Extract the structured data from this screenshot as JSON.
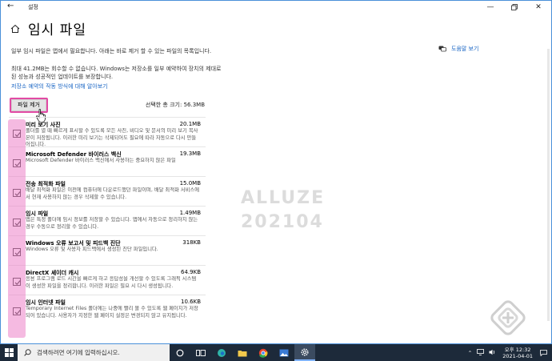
{
  "window": {
    "app_title": "설정",
    "page_title": "임시 파일",
    "description": "일부 임시 파일은 앱에서 필요합니다. 아래는 바로 제거 할 수 있는 파일의 목록입니다.",
    "storage_note": "최대 41.2MB는 회수할 수 없습니다. Windows는 저장소를 일부 예약하여 장치의 제대로 된 성능과 성공적인 업데이트를 보장합니다.",
    "storage_link": "저장소 예약의 작동 방식에 대해 알아보기",
    "help_link": "도움말 보기",
    "remove_button": "파일 제거",
    "selected_size": "선택한 총 크기: 56.3MB"
  },
  "items": [
    {
      "name": "미리 보기 사진",
      "size": "20.1MB",
      "desc": "폴더를 열 때 빠르게 표시할 수 있도록 모든 사진, 비디오 및 문서의 미리 보기 복사본이 저장됩니다. 이러한 미리 보기는 삭제되어도 필요에 따라 자동으로 다시 만들어집니다.",
      "checked": true
    },
    {
      "name": "Microsoft Defender 바이러스 백신",
      "size": "19.3MB",
      "desc": "Microsoft Defender 바이러스 백신에서 사용하는 중요하지 않은 파일",
      "checked": true
    },
    {
      "name": "전송 최적화 파일",
      "size": "15.0MB",
      "desc": "배달 최적화 파일은 이전에 컴퓨터에 다운로드했던 파일이며, 배달 최적화 서비스에서 현재 사용하지 않는 경우 삭제할 수 있습니다.",
      "checked": true
    },
    {
      "name": "임시 파일",
      "size": "1.49MB",
      "desc": "앱은 특정 폴더에 임시 정보를 저장할 수 있습니다. 앱에서 자동으로 정리하지 않는 경우 수동으로 정리할 수 있습니다.",
      "checked": true
    },
    {
      "name": "Windows 오류 보고서 및 피드백 진단",
      "size": "318KB",
      "desc": "Windows 오류 및 사용자 피드백에서 생성된 진단 파일입니다.",
      "checked": true
    },
    {
      "name": "DirectX 셰이더 캐시",
      "size": "64.9KB",
      "desc": "응용 프로그램 로드 시간을 빠르게 하고 응답성을 개선할 수 있도록 그래픽 시스템이 생성한 파일을 정리합니다. 이러한 파일은 필요 시 다시 생성됩니다.",
      "checked": true
    },
    {
      "name": "임시 인터넷 파일",
      "size": "10.6KB",
      "desc": "Temporary Internet Files 폴더에는 나중에 빨리 볼 수 있도록 웹 페이지가 저장되어 있습니다. 사용자가 지정한 웹 페이지 설정은 변경되지 않고 유지됩니다.",
      "checked": true
    }
  ],
  "watermark": {
    "line1": "ALLUZE",
    "line2": "202104"
  },
  "taskbar": {
    "search_placeholder": "검색하려면 여기에 입력하십시오.",
    "time": "오후 12:32",
    "date": "2021-04-01"
  },
  "colors": {
    "accent": "#1a66c4",
    "highlight": "#e24aa4",
    "taskbar": "#1d2a3a"
  }
}
